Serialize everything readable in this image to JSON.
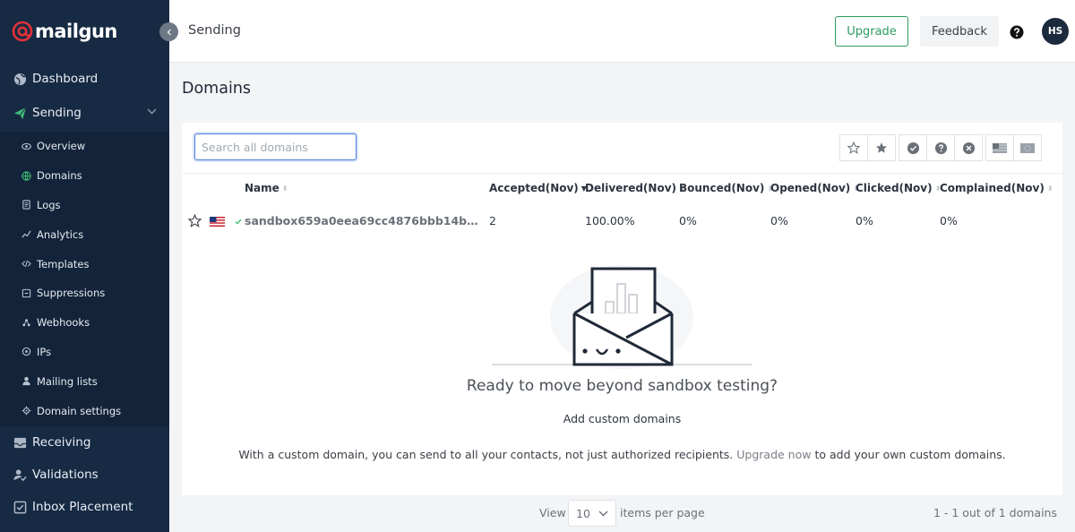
{
  "brand": {
    "name": "mailgun",
    "accent": "#e0323a",
    "sidebar_bg": "#172a43",
    "green": "#2b9b63"
  },
  "sidebar": {
    "top_items": [
      {
        "label": "Dashboard",
        "icon": "globe-icon"
      },
      {
        "label": "Sending",
        "icon": "paper-plane-icon",
        "expanded": true
      }
    ],
    "sub_items": [
      {
        "label": "Overview",
        "icon": "eye-icon"
      },
      {
        "label": "Domains",
        "icon": "globe-icon",
        "active": true
      },
      {
        "label": "Logs",
        "icon": "document-icon"
      },
      {
        "label": "Analytics",
        "icon": "chart-line-icon"
      },
      {
        "label": "Templates",
        "icon": "code-icon"
      },
      {
        "label": "Suppressions",
        "icon": "block-icon"
      },
      {
        "label": "Webhooks",
        "icon": "webhook-icon"
      },
      {
        "label": "IPs",
        "icon": "location-pin-icon"
      },
      {
        "label": "Mailing lists",
        "icon": "user-icon"
      },
      {
        "label": "Domain settings",
        "icon": "gear-icon"
      }
    ],
    "bottom_items": [
      {
        "label": "Receiving",
        "icon": "inbox-icon"
      },
      {
        "label": "Validations",
        "icon": "user-check-icon"
      },
      {
        "label": "Inbox Placement",
        "icon": "check-square-icon"
      }
    ]
  },
  "header": {
    "breadcrumb": "Sending",
    "upgrade_label": "Upgrade",
    "feedback_label": "Feedback",
    "avatar_initials": "HS"
  },
  "page": {
    "title": "Domains"
  },
  "search": {
    "placeholder": "Search all domains",
    "value": ""
  },
  "table": {
    "columns": [
      "Name",
      "Accepted(Nov)",
      "Delivered(Nov)",
      "Bounced(Nov)",
      "Opened(Nov)",
      "Clicked(Nov)",
      "Complained(Nov)"
    ],
    "rows": [
      {
        "name": "sandbox659a0eea69cc4876bbb14b1c28...",
        "accepted": "2",
        "delivered": "100.00%",
        "bounced": "0%",
        "opened": "0%",
        "clicked": "0%",
        "complained": "0%"
      }
    ]
  },
  "empty_state": {
    "title": "Ready to move beyond sandbox testing?",
    "link": "Add custom domains",
    "desc_before": "With a custom domain, you can send to all your contacts, not just authorized recipients. ",
    "desc_link": "Upgrade now",
    "desc_after": " to add your own custom domains."
  },
  "pagination": {
    "view_label": "View",
    "per_page": "10",
    "per_page_label": "items per page",
    "range_text": "1 - 1 out of 1 domains"
  }
}
